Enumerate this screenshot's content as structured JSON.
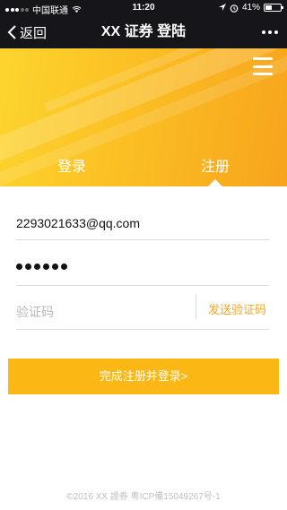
{
  "status_bar": {
    "carrier": "中国联通",
    "time": "11:20",
    "battery": "41%",
    "battery_level": 0.41
  },
  "nav": {
    "back_label": "返回",
    "title": "XX 证券 登陆"
  },
  "hero": {
    "tab_login": "登录",
    "tab_register": "注册",
    "active_tab": "tab_register",
    "accent_color": "#fbb714"
  },
  "form": {
    "email_value": "2293021633@qq.com",
    "password_length": 6,
    "code_placeholder": "验证码",
    "send_code_label": "发送验证码",
    "submit_label": "完成注册并登录>"
  },
  "footer": {
    "text": "©2016 XX 證券 粵ICP備15049267号-1"
  },
  "icons": {
    "back": "chevron-left-icon",
    "more": "more-dots-icon",
    "menu": "hamburger-menu-icon",
    "wifi": "wifi-icon",
    "alarm": "alarm-icon",
    "location": "location-icon",
    "battery": "battery-icon"
  }
}
